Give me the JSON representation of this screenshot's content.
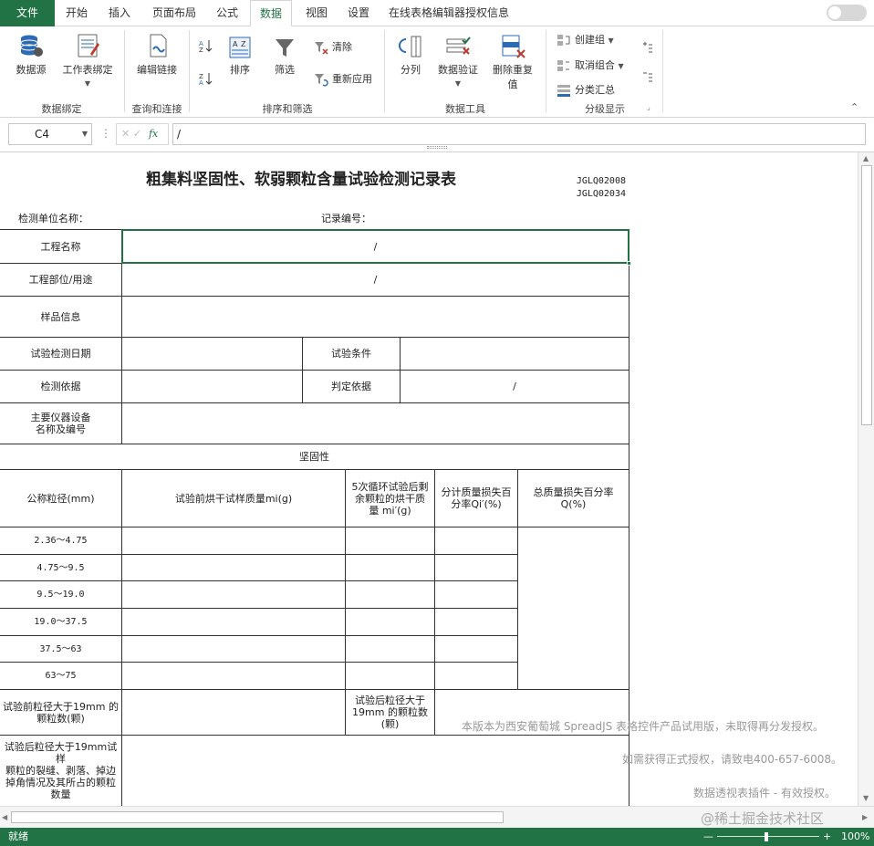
{
  "tabs": {
    "file": "文件",
    "home": "开始",
    "insert": "插入",
    "page_layout": "页面布局",
    "formulas": "公式",
    "data": "数据",
    "view": "视图",
    "settings": "设置",
    "license": "在线表格编辑器授权信息"
  },
  "ribbon": {
    "data_source": "数据源",
    "sheet_binding": "工作表绑定",
    "group_data_binding": "数据绑定",
    "edit_links": "编辑链接",
    "group_query": "查询和连接",
    "sort": "排序",
    "filter": "筛选",
    "clear": "清除",
    "reapply": "重新应用",
    "group_sort_filter": "排序和筛选",
    "split_column": "分列",
    "data_validation": "数据验证",
    "remove_duplicates_1": "删除重复",
    "remove_duplicates_2": "值",
    "group_data_tools": "数据工具",
    "create_group": "创建组",
    "ungroup": "取消组合",
    "subtotal": "分类汇总",
    "group_outline": "分级显示"
  },
  "formula_bar": {
    "name_box": "C4",
    "formula": "/"
  },
  "sheet": {
    "title": "粗集料坚固性、软弱颗粒含量试验检测记录表",
    "code1": "JGLQ02008",
    "code2": "JGLQ02034",
    "unit_label": "检测单位名称：",
    "record_no_label": "记录编号：",
    "project_name": "工程名称",
    "project_name_value": "/",
    "project_part": "工程部位/用途",
    "project_part_value": "/",
    "sample_info": "样品信息",
    "test_date": "试验检测日期",
    "test_condition": "试验条件",
    "test_basis": "检测依据",
    "judge_basis": "判定依据",
    "judge_basis_value": "/",
    "main_equipment_1": "主要仪器设备",
    "main_equipment_2": "名称及编号",
    "soundness": "坚固性",
    "col_size": "公称粒径(mm)",
    "col_pre_mass": "试验前烘干试样质量mi(g)",
    "col_post_mass_1": "5次循环试验后剩",
    "col_post_mass_2": "余颗粒的烘干质",
    "col_post_mass_3": "量 mi′(g)",
    "col_loss_1": "分计质量损失百",
    "col_loss_2": "分率Qi′(%)",
    "col_total_1": "总质量损失百分率",
    "col_total_2": "Q(%)",
    "sizes": [
      "2.36～4.75",
      "4.75～9.5",
      "9.5～19.0",
      "19.0～37.5",
      "37.5～63",
      "63～75"
    ],
    "pre_count_1": "试验前粒径大于19mm 的",
    "pre_count_2": "颗粒数(颗)",
    "post_count_1": "试验后粒径大于",
    "post_count_2": "19mm 的颗粒数",
    "post_count_3": "(颗)",
    "crack_1": "试验后粒径大于19mm试样",
    "crack_2": "颗粒的裂缝、剥落、掉边",
    "crack_3": "掉角情况及其所占的颗粒",
    "crack_4": "数量"
  },
  "watermark": {
    "line1": "本版本为西安葡萄城 SpreadJS 表格控件产品试用版，未取得再分发授权。",
    "line2": "如需获得正式授权，请致电400-657-6008。",
    "line3": "数据透视表插件 - 有效授权。",
    "line4": "@稀土掘金技术社区"
  },
  "status": {
    "ready": "就绪",
    "zoom": "100%"
  },
  "colors": {
    "accent": "#217346"
  }
}
